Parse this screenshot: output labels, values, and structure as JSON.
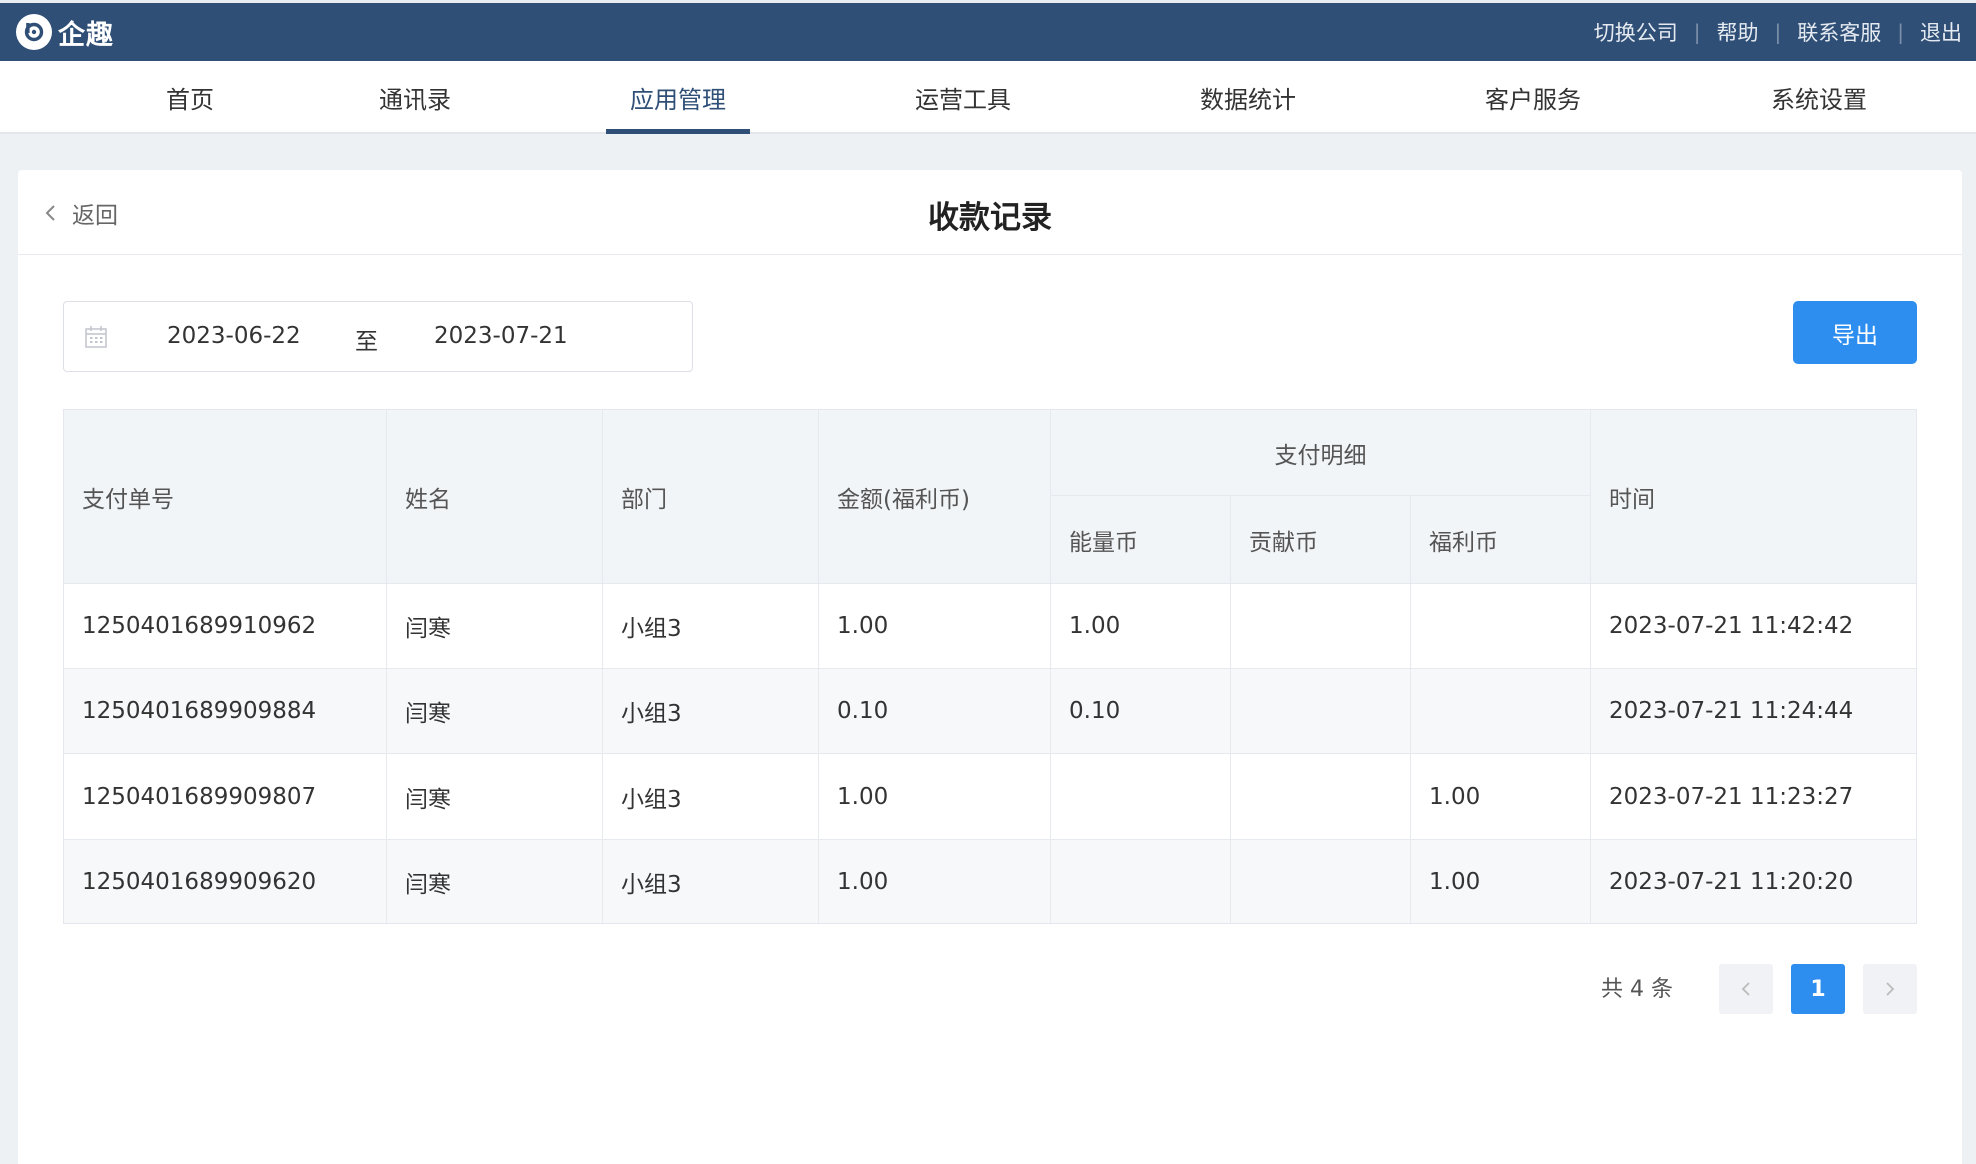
{
  "app": {
    "name": "企趣"
  },
  "top_links": [
    "切换公司",
    "帮助",
    "联系客服",
    "退出"
  ],
  "nav": {
    "items": [
      "首页",
      "通讯录",
      "应用管理",
      "运营工具",
      "数据统计",
      "客户服务",
      "系统设置"
    ],
    "active": "应用管理"
  },
  "page": {
    "back_label": "返回",
    "title": "收款记录"
  },
  "filter": {
    "start_date": "2023-06-22",
    "separator": "至",
    "end_date": "2023-07-21",
    "export_label": "导出"
  },
  "table": {
    "headers": {
      "order_no": "支付单号",
      "name": "姓名",
      "dept": "部门",
      "amount": "金额(福利币)",
      "detail_group": "支付明细",
      "energy": "能量币",
      "contribution": "贡献币",
      "welfare": "福利币",
      "time": "时间"
    },
    "rows": [
      {
        "order_no": "1250401689910962",
        "name": "闫寒",
        "dept": "小组3",
        "amount": "1.00",
        "energy": "1.00",
        "contribution": "",
        "welfare": "",
        "time": "2023-07-21 11:42:42"
      },
      {
        "order_no": "1250401689909884",
        "name": "闫寒",
        "dept": "小组3",
        "amount": "0.10",
        "energy": "0.10",
        "contribution": "",
        "welfare": "",
        "time": "2023-07-21 11:24:44"
      },
      {
        "order_no": "1250401689909807",
        "name": "闫寒",
        "dept": "小组3",
        "amount": "1.00",
        "energy": "",
        "contribution": "",
        "welfare": "1.00",
        "time": "2023-07-21 11:23:27"
      },
      {
        "order_no": "1250401689909620",
        "name": "闫寒",
        "dept": "小组3",
        "amount": "1.00",
        "energy": "",
        "contribution": "",
        "welfare": "1.00",
        "time": "2023-07-21 11:20:20"
      }
    ]
  },
  "pagination": {
    "total_label": "共 4 条",
    "current_page": "1"
  },
  "colors": {
    "header_bg": "#2f4f77",
    "primary": "#2e8ef0"
  }
}
